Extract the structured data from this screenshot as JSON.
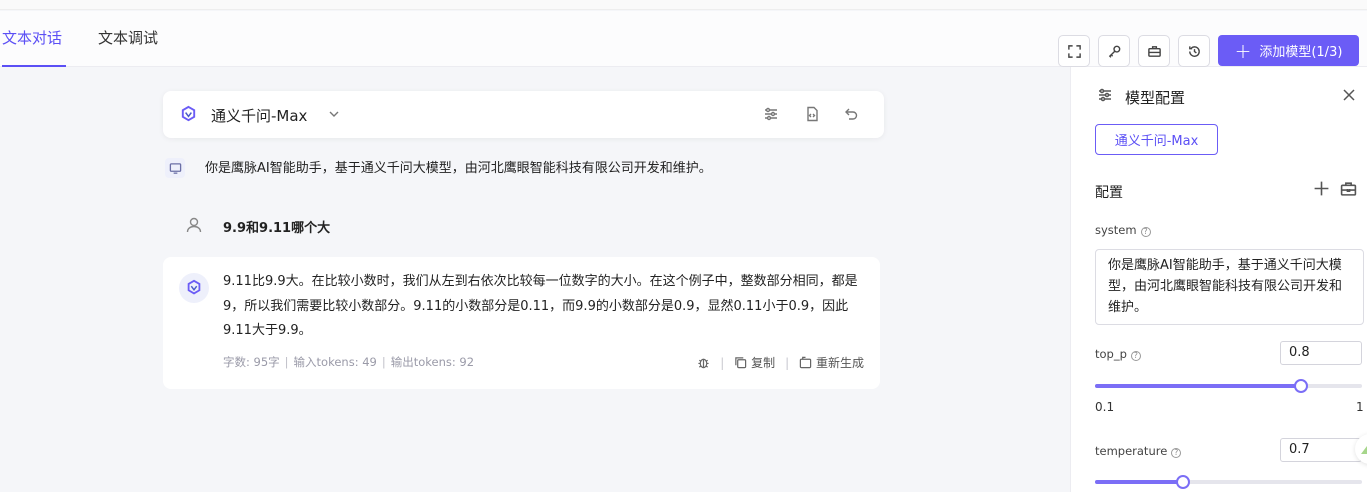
{
  "header": {
    "tabs": [
      {
        "label": "文本对话",
        "active": true
      },
      {
        "label": "文本调试",
        "active": false
      }
    ],
    "icon_buttons": [
      "fullscreen-icon",
      "key-icon",
      "toolbox-icon",
      "history-icon"
    ],
    "add_model_label": "添加模型(1/3)"
  },
  "chat": {
    "model_name": "通义千问-Max",
    "system_message": "你是鹰脉AI智能助手，基于通义千问大模型，由河北鹰眼智能科技有限公司开发和维护。",
    "user_message": "9.9和9.11哪个大",
    "assistant_message": "9.11比9.9大。在比较小数时，我们从左到右依次比较每一位数字的大小。在这个例子中，整数部分相同，都是9，所以我们需要比较小数部分。9.11的小数部分是0.11，而9.9的小数部分是0.9，显然0.11小于0.9，因此9.11大于9.9。",
    "meta": {
      "word_count": "字数: 95字",
      "input_tokens": "输入tokens: 49",
      "output_tokens": "输出tokens: 92"
    },
    "actions": {
      "copy": "复制",
      "regenerate": "重新生成"
    }
  },
  "panel": {
    "title": "模型配置",
    "model_tag": "通义千问-Max",
    "config_label": "配置",
    "system_label": "system",
    "system_value": "你是鹰脉AI智能助手，基于通义千问大模型，由河北鹰眼智能科技有限公司开发和维护。",
    "top_p": {
      "label": "top_p",
      "value": "0.8",
      "min": "0.1",
      "max": "1"
    },
    "temperature": {
      "label": "temperature",
      "value": "0.7"
    }
  },
  "colors": {
    "accent": "#6b5cf6"
  }
}
